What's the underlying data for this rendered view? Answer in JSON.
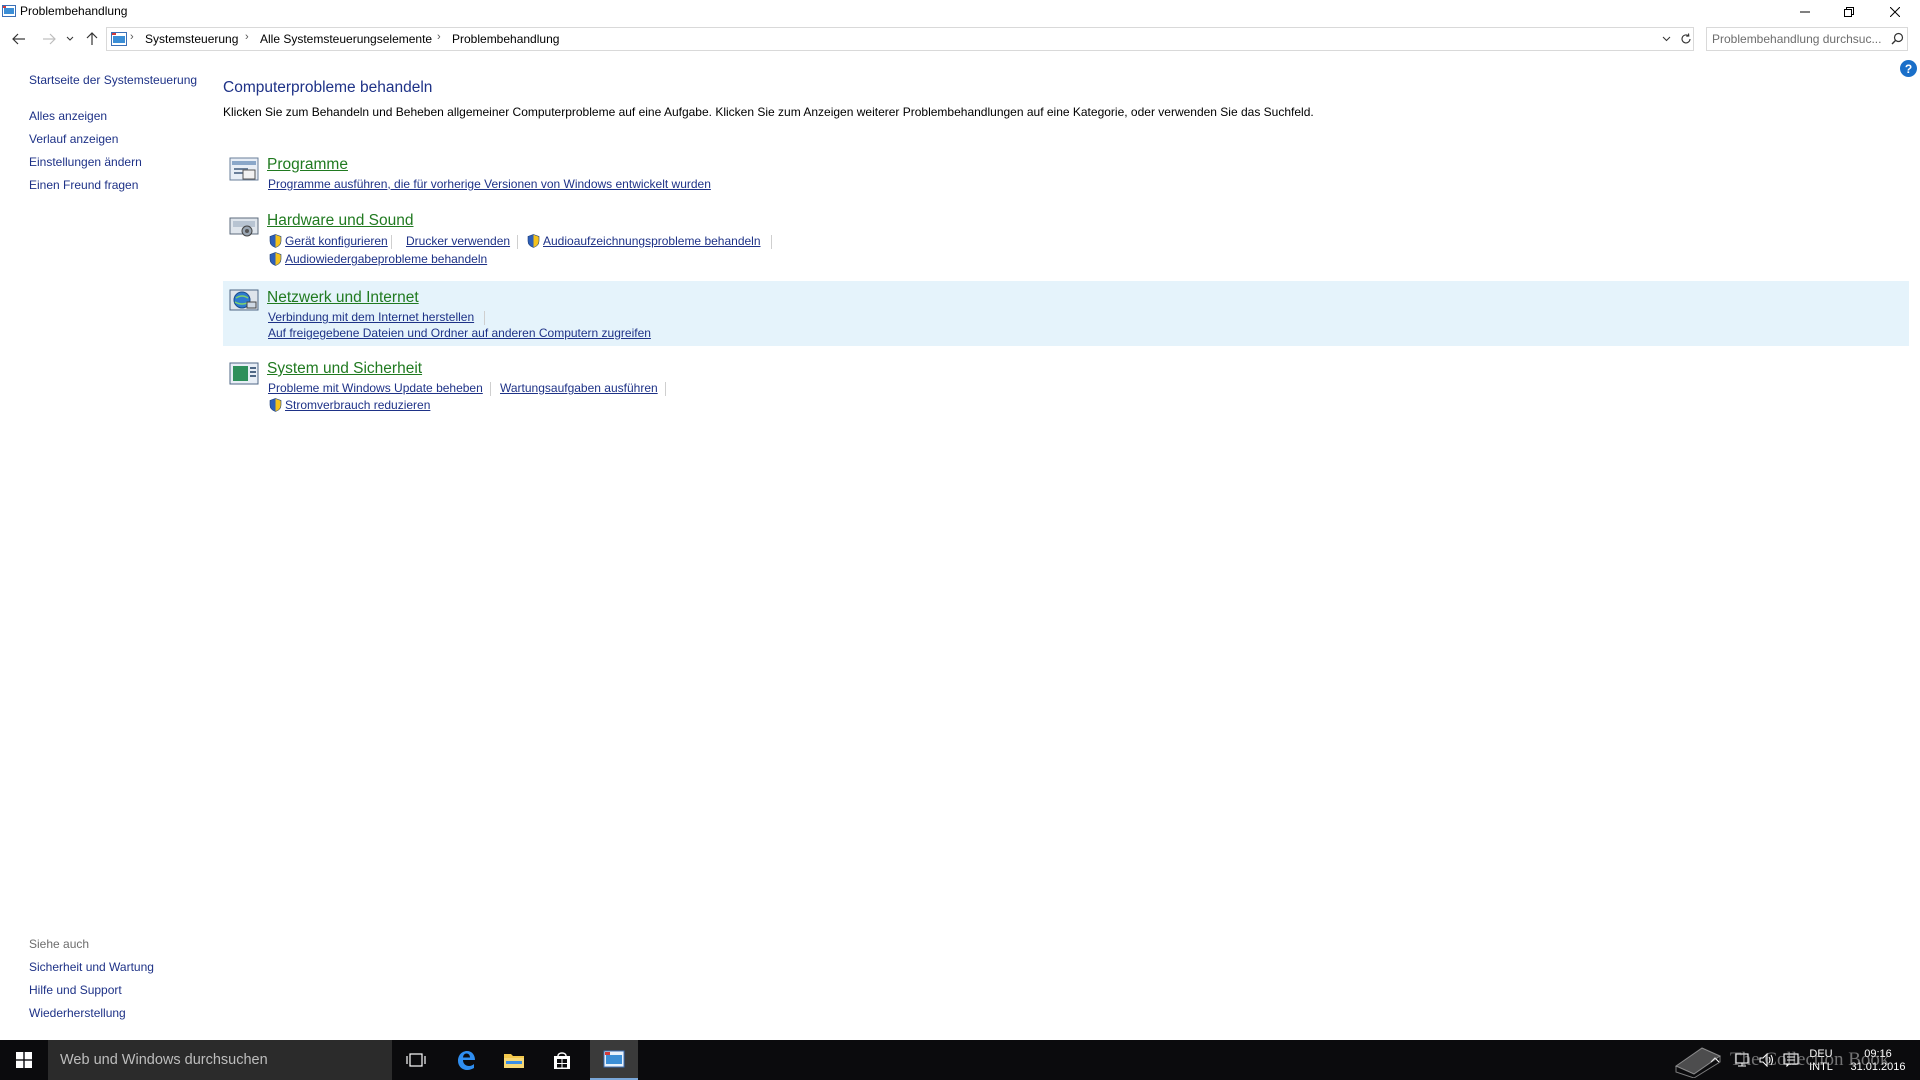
{
  "window": {
    "title": "Problembehandlung"
  },
  "address": {
    "breadcrumbs": [
      "Systemsteuerung",
      "Alle Systemsteuerungselemente",
      "Problembehandlung"
    ],
    "search_placeholder": "Problembehandlung durchsuc..."
  },
  "leftnav": {
    "home": "Startseite der Systemsteuerung",
    "items": [
      "Alles anzeigen",
      "Verlauf anzeigen",
      "Einstellungen ändern",
      "Einen Freund fragen"
    ]
  },
  "seealso": {
    "heading": "Siehe auch",
    "items": [
      "Sicherheit und Wartung",
      "Hilfe und Support",
      "Wiederherstellung"
    ]
  },
  "main": {
    "title": "Computerprobleme behandeln",
    "description": "Klicken Sie zum Behandeln und Beheben allgemeiner Computerprobleme auf eine Aufgabe. Klicken Sie zum Anzeigen weiterer Problembehandlungen auf eine Kategorie, oder verwenden Sie das Suchfeld.",
    "categories": [
      {
        "title": "Programme",
        "tasks": [
          "Programme ausführen, die für vorherige Versionen von Windows entwickelt wurden"
        ]
      },
      {
        "title": "Hardware und Sound",
        "tasks": [
          "Gerät konfigurieren",
          "Drucker verwenden",
          "Audioaufzeichnungsprobleme behandeln",
          "Audiowiedergabeprobleme behandeln"
        ]
      },
      {
        "title": "Netzwerk und Internet",
        "tasks": [
          "Verbindung mit dem Internet herstellen",
          "Auf freigegebene Dateien und Ordner auf anderen Computern zugreifen"
        ]
      },
      {
        "title": "System und Sicherheit",
        "tasks": [
          "Probleme mit Windows Update beheben",
          "Wartungsaufgaben ausführen",
          "Stromverbrauch reduzieren"
        ]
      }
    ]
  },
  "help_icon_label": "?",
  "taskbar": {
    "search_placeholder": "Web und Windows durchsuchen",
    "lang_top": "DEU",
    "lang_bottom": "INTL",
    "time": "09:16",
    "date": "31.01.2016"
  },
  "watermark": "The Collection Book",
  "colors": {
    "link": "#1e3287",
    "category_title": "#207a20",
    "highlight": "#e5f3fb",
    "taskbar": "#0b0b0d"
  }
}
